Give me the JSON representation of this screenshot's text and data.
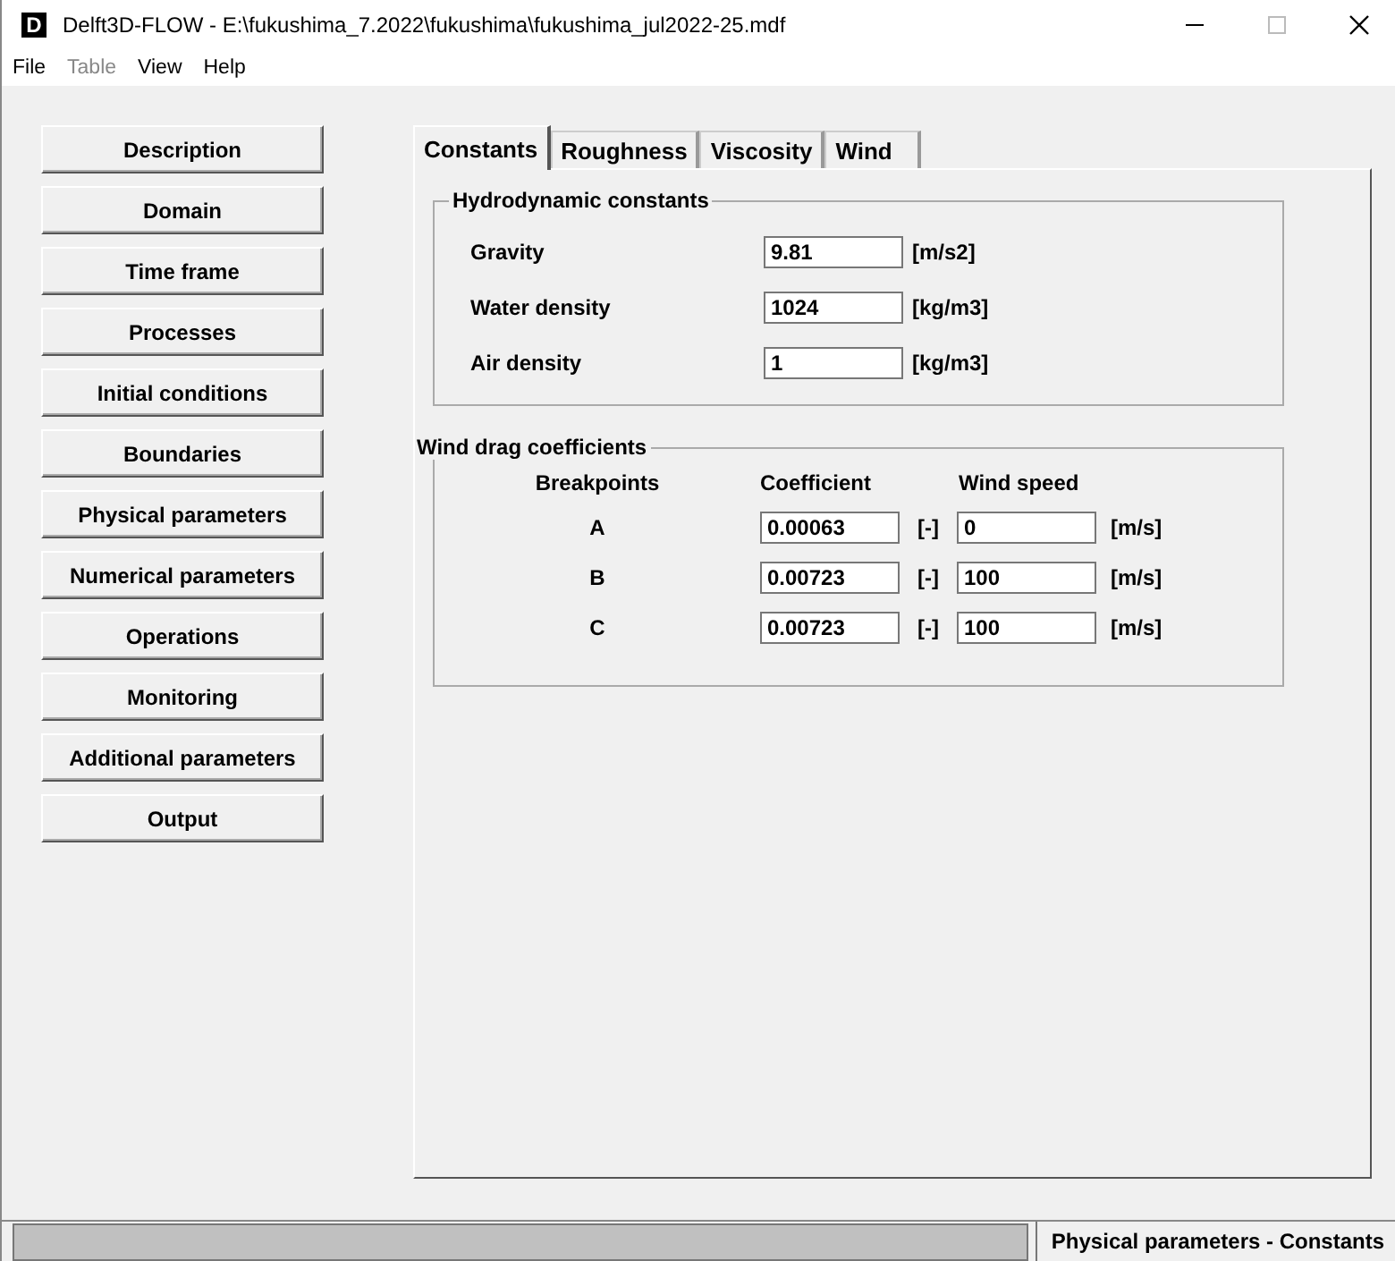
{
  "window": {
    "title": "Delft3D-FLOW - E:\\fukushima_7.2022\\fukushima\\fukushima_jul2022-25.mdf",
    "app_icon_letter": "D"
  },
  "menu": [
    {
      "label": "File",
      "disabled": false
    },
    {
      "label": "Table",
      "disabled": true
    },
    {
      "label": "View",
      "disabled": false
    },
    {
      "label": "Help",
      "disabled": false
    }
  ],
  "sidebar": {
    "buttons": [
      "Description",
      "Domain",
      "Time frame",
      "Processes",
      "Initial conditions",
      "Boundaries",
      "Physical parameters",
      "Numerical parameters",
      "Operations",
      "Monitoring",
      "Additional parameters",
      "Output"
    ]
  },
  "tabs": [
    {
      "label": "Constants",
      "selected": true
    },
    {
      "label": "Roughness",
      "selected": false
    },
    {
      "label": "Viscosity",
      "selected": false
    },
    {
      "label": "Wind",
      "selected": false
    }
  ],
  "hydrodynamic_constants": {
    "title": "Hydrodynamic constants",
    "fields": [
      {
        "label": "Gravity",
        "value": "9.81",
        "unit": "[m/s2]"
      },
      {
        "label": "Water density",
        "value": "1024",
        "unit": "[kg/m3]"
      },
      {
        "label": "Air density",
        "value": "1",
        "unit": "[kg/m3]"
      }
    ]
  },
  "wind_drag": {
    "title": "Wind drag coefficients",
    "columns": [
      "Breakpoints",
      "Coefficient",
      "Wind speed"
    ],
    "rows": [
      {
        "breakpoint": "A",
        "coefficient": "0.00063",
        "coefficient_unit": "[-]",
        "wind_speed": "0",
        "wind_speed_unit": "[m/s]"
      },
      {
        "breakpoint": "B",
        "coefficient": "0.00723",
        "coefficient_unit": "[-]",
        "wind_speed": "100",
        "wind_speed_unit": "[m/s]"
      },
      {
        "breakpoint": "C",
        "coefficient": "0.00723",
        "coefficient_unit": "[-]",
        "wind_speed": "100",
        "wind_speed_unit": "[m/s]"
      }
    ]
  },
  "status_bar": {
    "text": "Physical parameters - Constants"
  }
}
